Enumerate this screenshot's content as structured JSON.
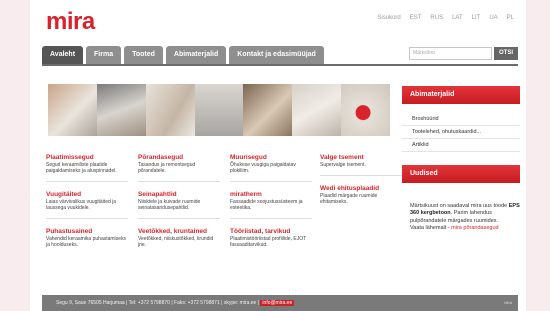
{
  "logo": "mira",
  "languages": [
    "Sisukord",
    "EST",
    "RUS",
    "LAT",
    "LIT",
    "UA",
    "PL"
  ],
  "nav": [
    "Avaleht",
    "Firma",
    "Tooted",
    "Abimaterjalid",
    "Kontakt ja edasimüüjad"
  ],
  "search": {
    "placeholder": "Märksõna",
    "button": "OTSI"
  },
  "columns": [
    [
      {
        "title": "Plaatimissegud",
        "desc": "Segud keraamiliste plaatide paigaldamiseks ja aluspinnadel."
      },
      {
        "title": "Vuugitäited",
        "desc": "Laias värvivalikus vuugitäited ja laussega vuukidele."
      },
      {
        "title": "Puhastusained",
        "desc": "Vahendid keraamika puhastamiseks ja hoolduseks."
      }
    ],
    [
      {
        "title": "Põrandasegud",
        "desc": "Tasandus ja remontsegud põrandatele."
      },
      {
        "title": "Seinapahtlid",
        "desc": "Niisktele ja kuivade ruumide seinatasandusepahtlid."
      },
      {
        "title": "Veetõkked, kruntained",
        "desc": "Veetõkked, niiskustõkked, krundid jne."
      }
    ],
    [
      {
        "title": "Muurisegud",
        "desc": "Õhukese vuugiga paigaldatav plokiliim."
      },
      {
        "title": "miratherm",
        "desc": "Fassaadide soojustussüsteem ja esteetika."
      },
      {
        "title": "Tööriistad, tarvikud",
        "desc": "Plaatimistööriistad profiilide, EJOT fassaaditarvikud."
      }
    ],
    [
      {
        "title": "Valge tsement",
        "desc": "Supervalge tsement."
      },
      {
        "title": "Wedi ehitusplaadid",
        "desc": "Plaadid märgade ruumide ehitamiseks."
      }
    ]
  ],
  "sidebar": {
    "materials_title": "Abimaterjalid",
    "links": [
      "Broshüürid",
      "Tootelehed, ohutuskaardid...",
      "Artiklid"
    ],
    "news_title": "Uudised",
    "news": {
      "t1": "Märtsikuust on saadaval mira uus toode ",
      "bold": "EPS 360 kergbetoon",
      "t2": ". Parim lahendus pulpõrandatele märgades ruumides.",
      "t3": "Vaata lähemalt - ",
      "link": "mira põrandasegud"
    }
  },
  "footer": {
    "text": "Segu 9, Saue 76505 Harjumaa | Tel: +372 5798870 | Faks: +372 5798871 | skype: mira.ee | ",
    "email": "info@mira.ee",
    "right": "Mira"
  },
  "colors": {
    "brand": "#d8232a",
    "nav": "#8e8e8e",
    "nav_active": "#555555"
  }
}
